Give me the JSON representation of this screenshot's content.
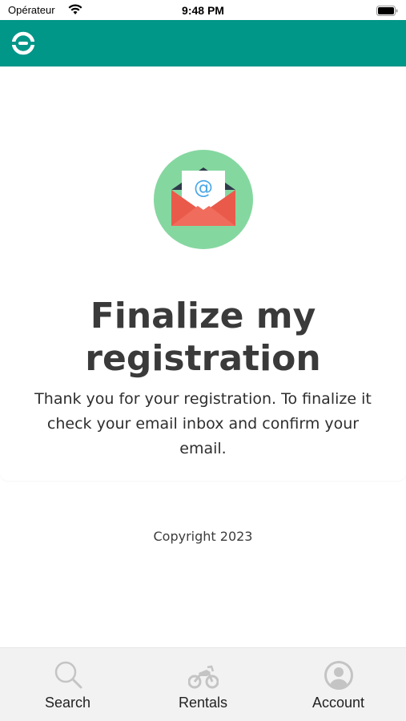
{
  "status_bar": {
    "carrier": "Opérateur",
    "time": "9:48 PM"
  },
  "app_bar": {
    "background": "#009688",
    "logo_icon": "app-logo-icon"
  },
  "main": {
    "illustration_icon": "email-envelope-icon",
    "title": "Finalize my registration",
    "message": "Thank you for your registration. To finalize it check your email inbox and confirm your email."
  },
  "footer": {
    "copyright": "Copyright 2023"
  },
  "tab_bar": {
    "tabs": [
      {
        "label": "Search",
        "icon": "search-icon"
      },
      {
        "label": "Rentals",
        "icon": "motorcycle-icon"
      },
      {
        "label": "Account",
        "icon": "account-icon"
      }
    ]
  }
}
